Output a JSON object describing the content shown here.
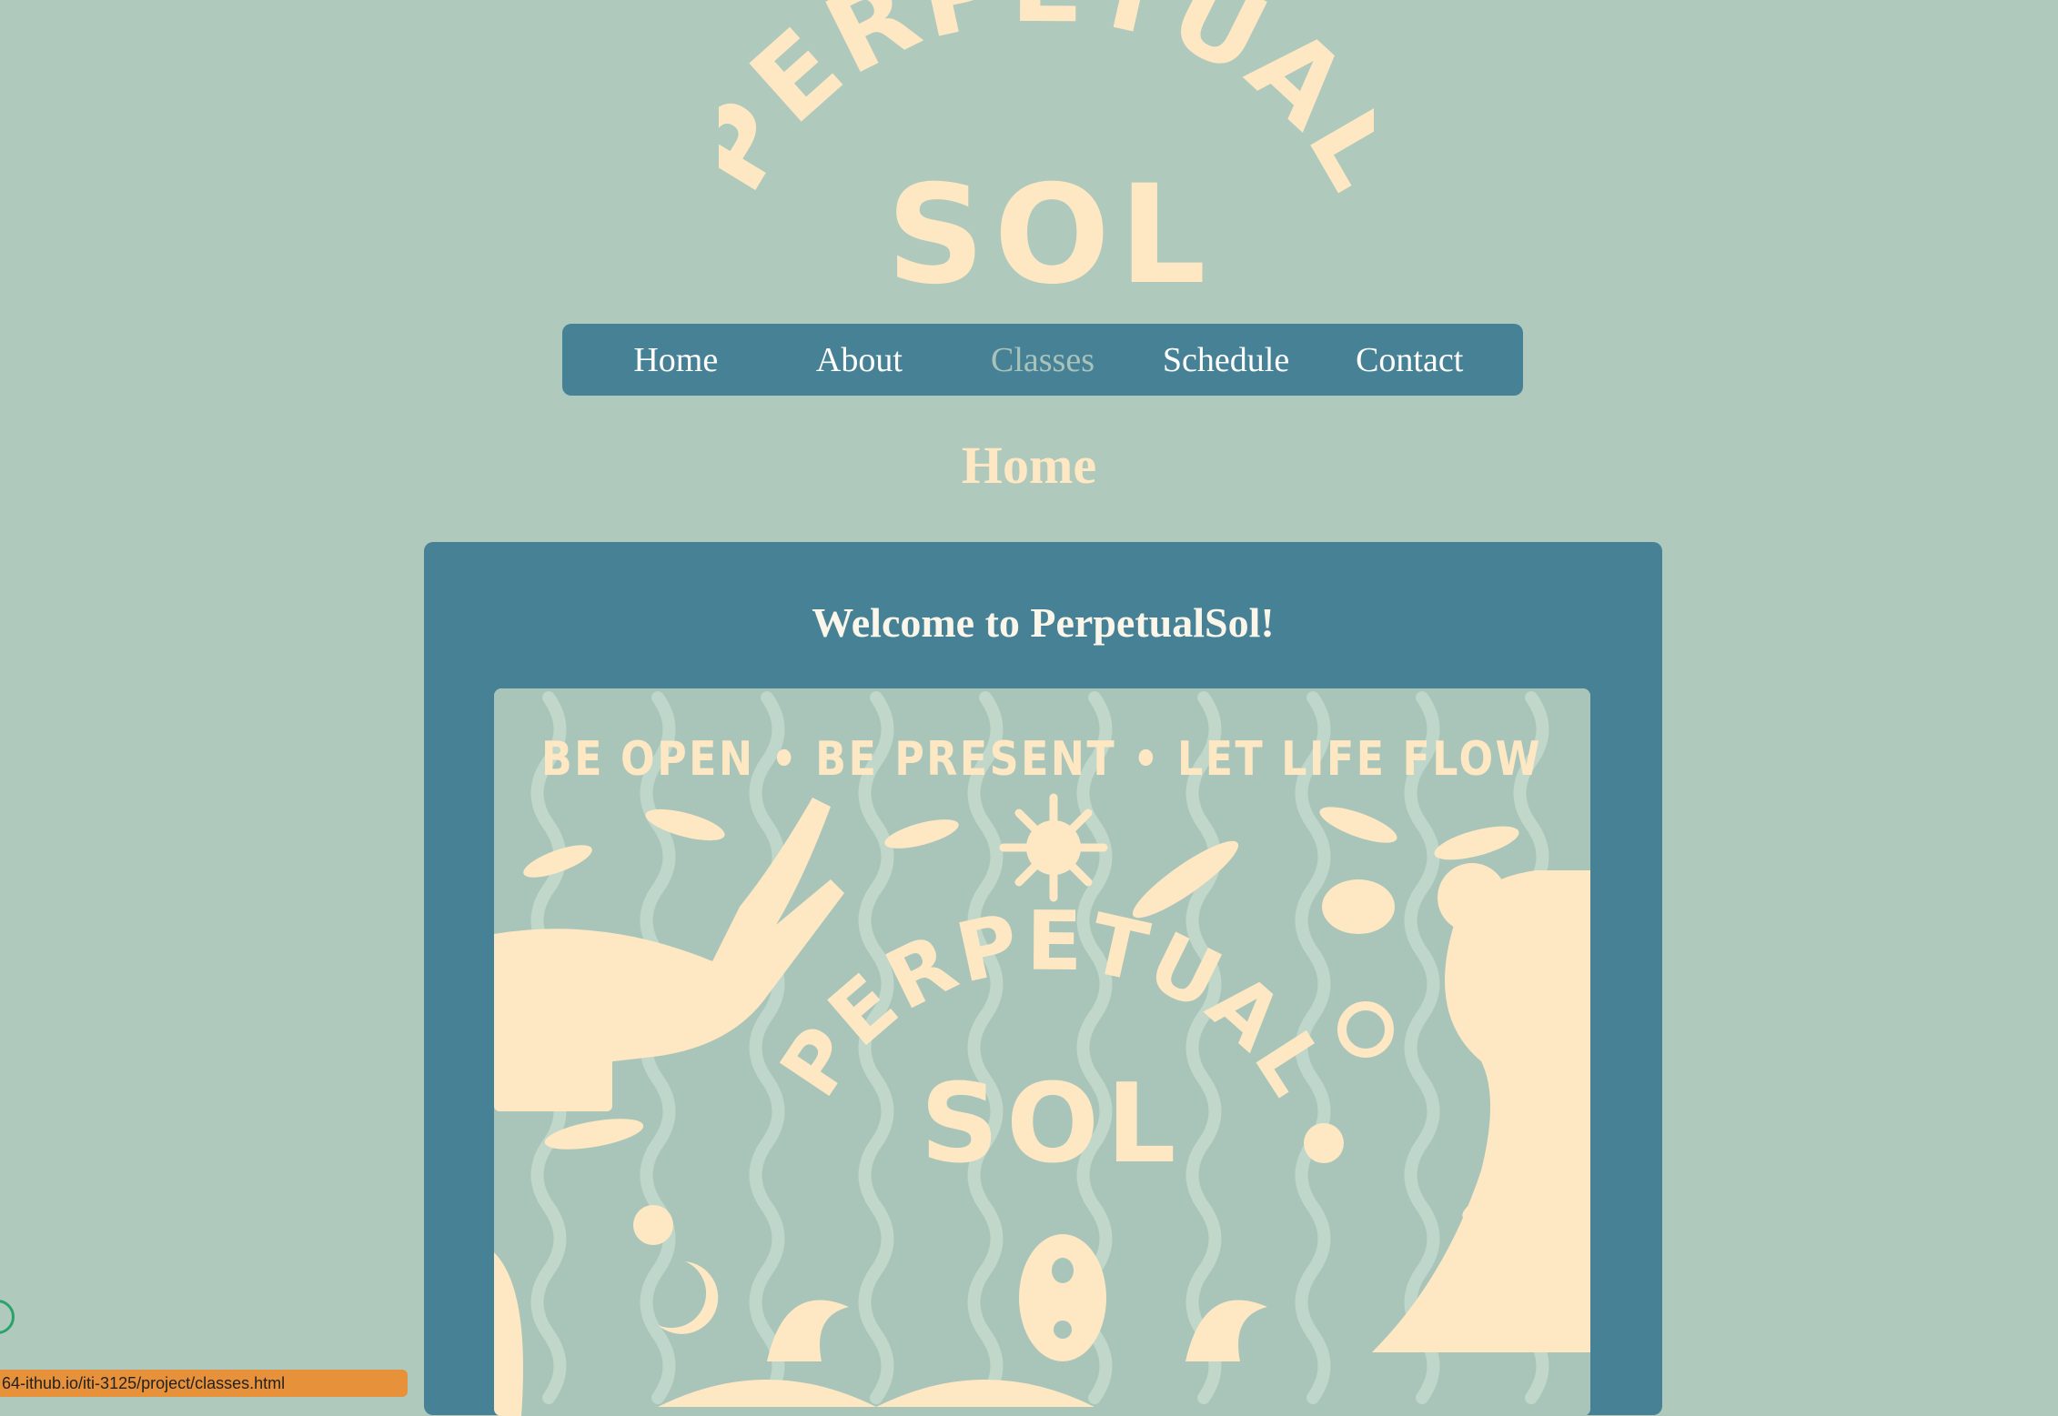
{
  "logo": {
    "line1": "PERPETUAL",
    "line2": "SOL"
  },
  "nav": {
    "items": [
      {
        "label": "Home"
      },
      {
        "label": "About"
      },
      {
        "label": "Classes"
      },
      {
        "label": "Schedule"
      },
      {
        "label": "Contact"
      }
    ],
    "active_index": 2
  },
  "page": {
    "title": "Home"
  },
  "card": {
    "welcome": "Welcome to PerpetualSol!"
  },
  "hero": {
    "motto": "BE OPEN • BE PRESENT • LET LIFE FLOW",
    "line1": "PERPETUAL",
    "line2": "SOL"
  },
  "status": {
    "text": "64-ithub.io/iti-3125/project/classes.html"
  },
  "colors": {
    "background": "#afc9bd",
    "nav_bg": "#468196",
    "cream": "#fde8c3",
    "active_link": "#a9c3bb",
    "status_bar": "#e8913b"
  }
}
